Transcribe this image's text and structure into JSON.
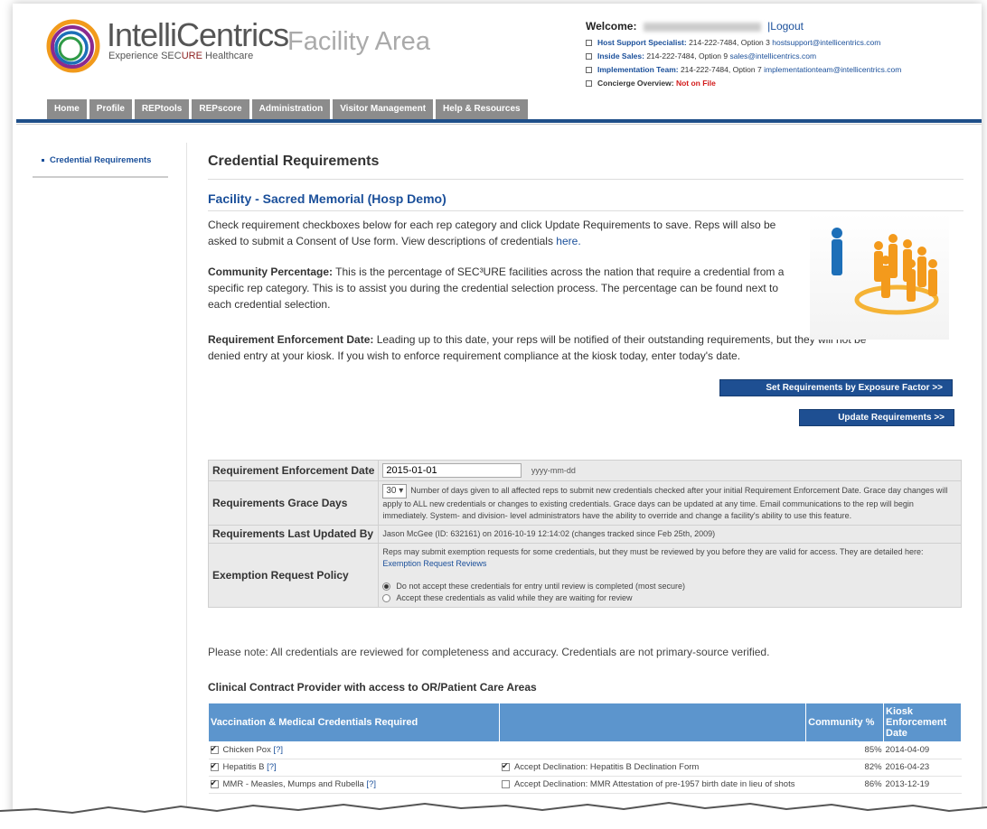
{
  "header": {
    "brand": "IntelliCentrics",
    "tagline_prefix": "Experience SEC",
    "tagline_sub": "URE",
    "tagline_suffix": " Healthcare",
    "area_title": "Facility Area",
    "welcome_label": "Welcome:",
    "logout": "|Logout",
    "contacts": [
      {
        "label": "Host Support Specialist:",
        "text": " 214-222-7484, Option 3 ",
        "email": "hostsupport@intellicentrics.com"
      },
      {
        "label": "Inside Sales:",
        "text": " 214-222-7484, Option 9 ",
        "email": "sales@intellicentrics.com"
      },
      {
        "label": "Implementation Team:",
        "text": " 214-222-7484, Option 7 ",
        "email": "implementationteam@intellicentrics.com"
      }
    ],
    "concierge_label": "Concierge Overview:",
    "concierge_value": "Not on File"
  },
  "nav": {
    "tabs": [
      "Home",
      "Profile",
      "REPtools",
      "REPscore",
      "Administration",
      "Visitor Management",
      "Help & Resources"
    ]
  },
  "sidebar": {
    "items": [
      "Credential Requirements"
    ]
  },
  "main": {
    "title": "Credential Requirements",
    "facility": "Facility - Sacred Memorial (Hosp Demo)",
    "intro": "Check requirement checkboxes below for each rep category and click Update Requirements to save. Reps will also be asked to submit a Consent of Use form. View descriptions of credentials ",
    "intro_link": "here.",
    "community_label": "Community Percentage:",
    "community_text": " This is the percentage of SEC³URE facilities across the nation that require a credential from a specific rep category. This is to assist you during the credential selection process. The percentage can be found next to each credential selection.",
    "enforcement_label": "Requirement Enforcement Date:",
    "enforcement_text": " Leading up to this date, your reps will be notified of their outstanding requirements, but they will not be denied entry at your kiosk. If you wish to enforce requirement compliance at the kiosk today, enter today's date.",
    "btn_exposure": "Set Requirements by Exposure Factor >>",
    "btn_update": "Update Requirements >>"
  },
  "settings": {
    "enforcement_label": "Requirement Enforcement Date",
    "enforcement_value": "2015-01-01",
    "enforcement_format": "yyyy-mm-dd",
    "grace_label": "Requirements Grace Days",
    "grace_value": "30 ▾",
    "grace_text": "Number of days given to all affected reps to submit new credentials checked after your initial Requirement Enforcement Date. Grace day changes will apply to ALL new credentials or changes to existing credentials. Grace days can be updated at any time. Email communications to the rep will begin immediately. System- and division- level administrators have the ability to override and change a facility's ability to use this feature.",
    "updated_label": "Requirements Last Updated By",
    "updated_value": "Jason McGee (ID: 632161) on 2016-10-19 12:14:02 (changes tracked since Feb 25th, 2009)",
    "exemption_label": "Exemption Request Policy",
    "exemption_text": "Reps may submit exemption requests for some credentials, but they must be reviewed by you before they are valid for access. They are detailed here: ",
    "exemption_link": "Exemption Request Reviews",
    "option1": "Do not accept these credentials for entry until review is completed (most secure)",
    "option2": "Accept these credentials as valid while they are waiting for review"
  },
  "note": "Please note: All credentials are reviewed for completeness and accuracy. Credentials are not primary-source verified.",
  "section_title": "Clinical Contract Provider with access to OR/Patient Care Areas",
  "creds": {
    "headers": [
      "Vaccination & Medical Credentials Required",
      "",
      "Community %",
      "Kiosk Enforcement Date"
    ],
    "rows": [
      {
        "name": "Chicken Pox",
        "help": "[?]",
        "decline": "",
        "pct": "85%",
        "date": "2014-04-09"
      },
      {
        "name": "Hepatitis B",
        "help": "[?]",
        "decline": "Accept Declination: Hepatitis B Declination Form",
        "pct": "82%",
        "date": "2016-04-23"
      },
      {
        "name": "MMR - Measles, Mumps and Rubella",
        "help": "[?]",
        "decline": "Accept Declination: MMR Attestation of pre-1957 birth date in lieu of shots",
        "pct": "86%",
        "date": "2013-12-19"
      }
    ]
  },
  "colors": {
    "nav_tab": "#8c8c8c",
    "rule_blue": "#1f4f89",
    "button": "#1e4f92",
    "table_header": "#5c95cd",
    "link": "#1a4f9a",
    "alert": "#d21b1b"
  }
}
